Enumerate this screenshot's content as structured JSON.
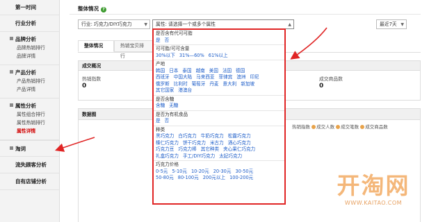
{
  "sidebar": {
    "top": "第一时间",
    "industry": "行业分析",
    "groups": [
      {
        "title": "品牌分析",
        "items": [
          "品牌热销排行",
          "品牌详情"
        ]
      },
      {
        "title": "产品分析",
        "items": [
          "产品热销排行",
          "产品详情"
        ]
      },
      {
        "title": "属性分析",
        "items": [
          "属性组合排行",
          "属性热销排行",
          "属性详情"
        ]
      }
    ],
    "bottom": [
      "淘词",
      "流失顾客分析",
      "自有店铺分析"
    ]
  },
  "header": {
    "title": "整体情况",
    "help": "?"
  },
  "filters": {
    "industry": "行业: 巧克力/DIY巧克力",
    "attribute": "属性: 请选择一个或多个属性",
    "period": "最近7天"
  },
  "tabs": [
    "整体情况",
    "热销宝贝排行"
  ],
  "deal": {
    "title": "成交概况",
    "hot_label": "热销指数",
    "hot_value": "0",
    "goods_label": "成交商品数",
    "goods_value": "0"
  },
  "data_chart": {
    "title": "数据图",
    "legend": [
      "热销指数",
      "成交人数",
      "成交笔数",
      "成交商品数"
    ]
  },
  "popup": {
    "sections": [
      {
        "title": "是否含有代可可脂",
        "rows": [
          [
            "是",
            "否"
          ]
        ]
      },
      {
        "title": "可可脂/可可含量",
        "rows": [
          [
            "30%以下",
            "31%—60%",
            "61%以上"
          ]
        ]
      },
      {
        "title": "产地",
        "rows": [
          [
            "韩国",
            "日本",
            "泰国",
            "越南",
            "美国",
            "法国",
            "德国"
          ],
          [
            "西班牙",
            "中国大陆",
            "马来西亚",
            "菲律宾",
            "澳洲",
            "印尼"
          ],
          [
            "俄罗斯",
            "比利时",
            "葡萄牙",
            "丹麦",
            "意大利",
            "新加坡"
          ],
          [
            "其它国家",
            "港澳台"
          ]
        ]
      },
      {
        "title": "是否含糖",
        "rows": [
          [
            "含糖",
            "无糖"
          ]
        ]
      },
      {
        "title": "是否为有机食品",
        "rows": [
          [
            "是",
            "否"
          ]
        ]
      },
      {
        "title": "种类",
        "rows": [
          [
            "黑巧克力",
            "白巧克力",
            "牛奶巧克力",
            "松露巧克力"
          ],
          [
            "榛仁巧克力",
            "饼干巧克力",
            "米古力",
            "酒心巧克力"
          ],
          [
            "巧克力豆",
            "巧克力棒",
            "其它种类",
            "夹心果仁巧克力"
          ],
          [
            "礼盒巧克力",
            "手工/DIY巧克力",
            "太妃巧克力"
          ]
        ]
      },
      {
        "title": "巧克力价格",
        "rows": [
          [
            "0-5元",
            "5-10元",
            "10-20元",
            "20-30元",
            "30-50元"
          ],
          [
            "50-80元",
            "80-100元",
            "200元以上",
            "100-200元"
          ]
        ]
      }
    ]
  },
  "watermark": {
    "logo": "开淘网",
    "url": "WWW.KAITAO.COM"
  },
  "colors": {
    "accent_red": "#e02424",
    "link_blue": "#1a5bc8",
    "watermark": "#f4b77a"
  }
}
